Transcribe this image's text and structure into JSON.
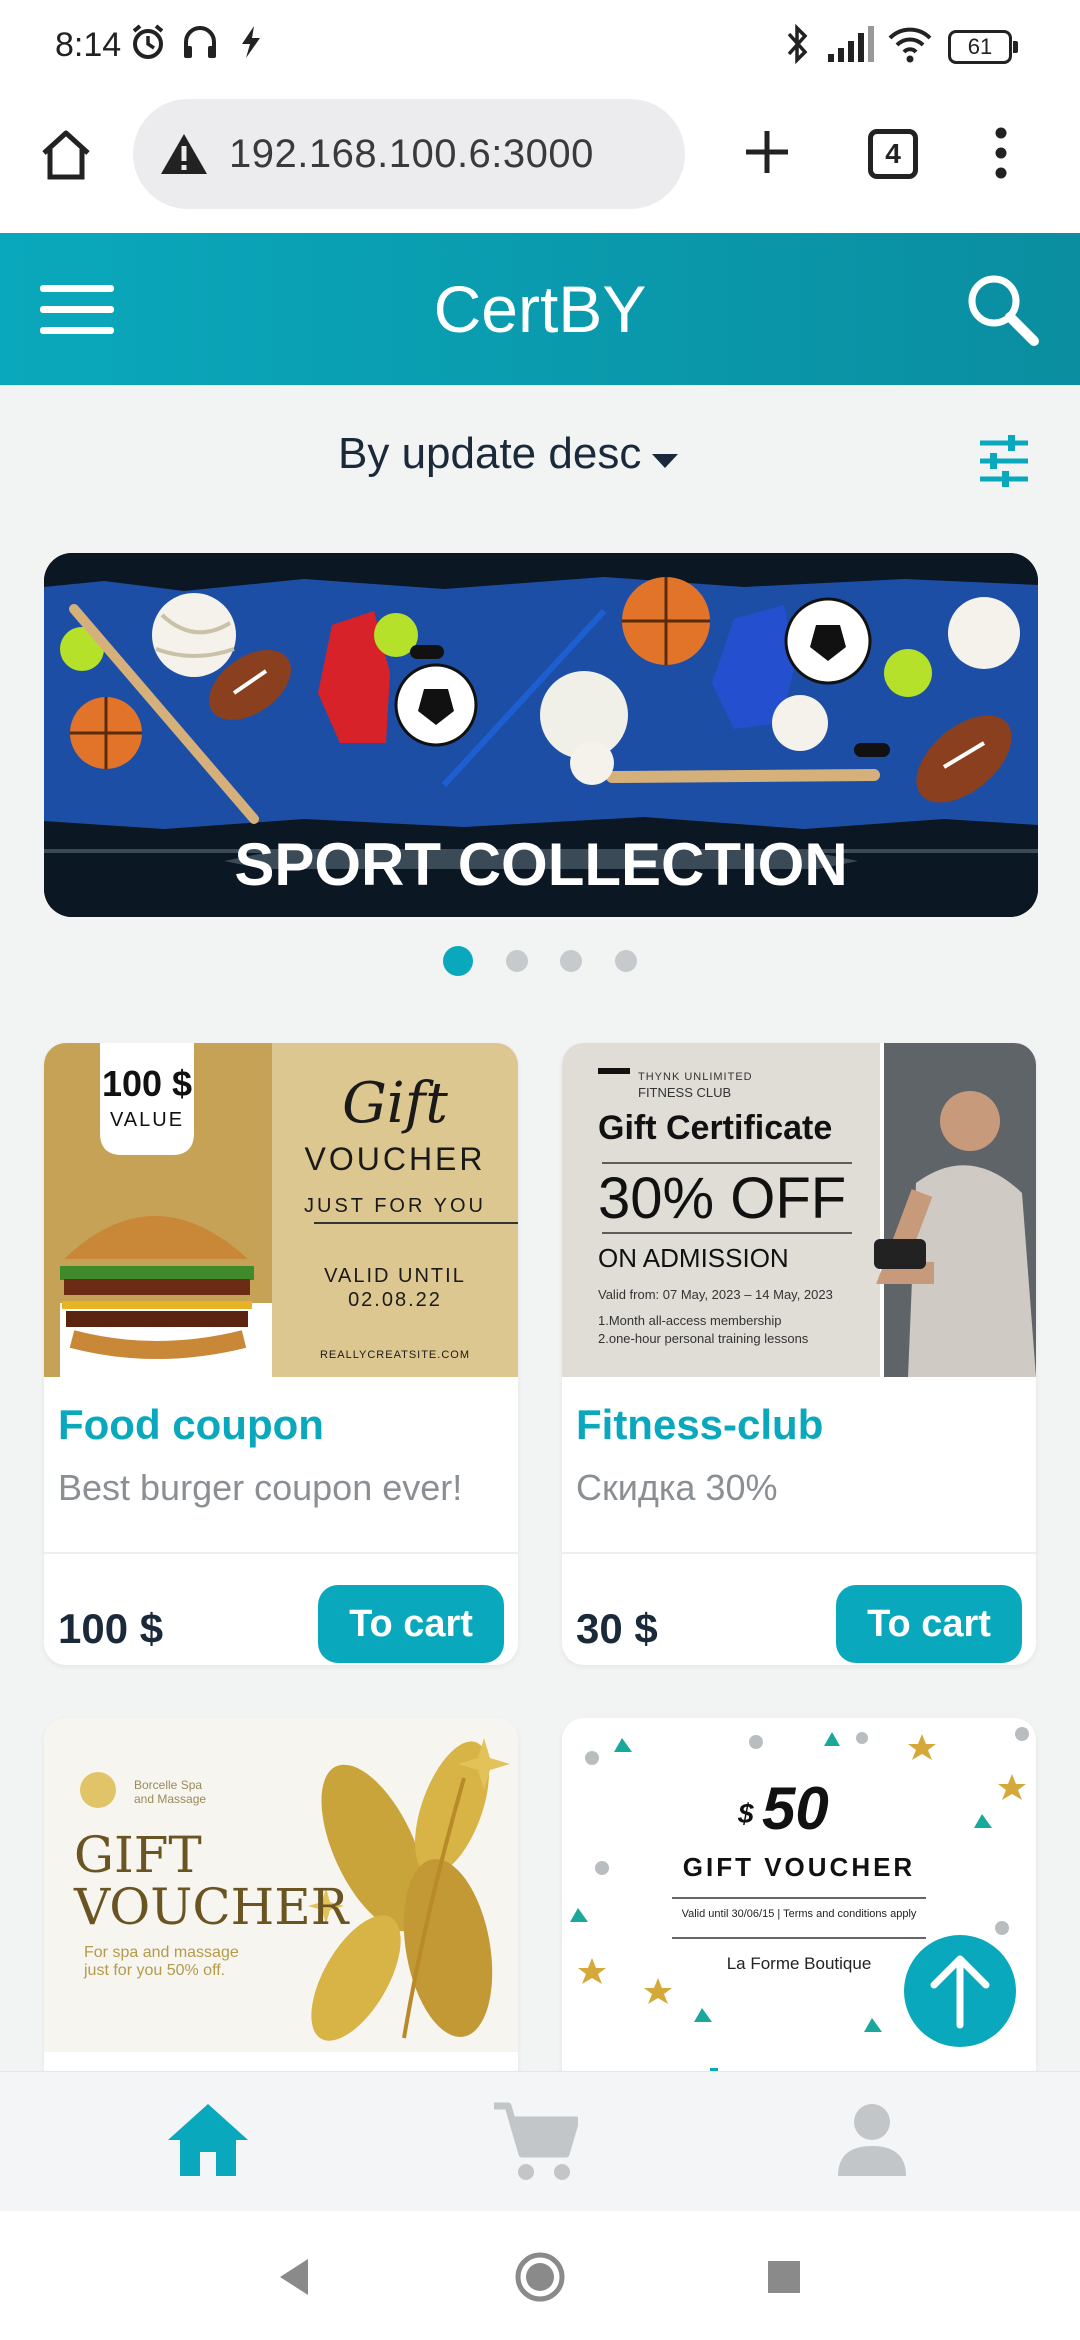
{
  "status_bar": {
    "time": "8:14",
    "battery": "61"
  },
  "browser": {
    "url": "192.168.100.6:3000",
    "tab_count": "4"
  },
  "header": {
    "title": "CertBY"
  },
  "sort": {
    "label": "By update desc"
  },
  "banner": {
    "caption": "SPORT COLLECTION",
    "slide_count": 4,
    "active_slide": 1
  },
  "products": [
    {
      "name": "Food coupon",
      "description": "Best burger coupon ever!",
      "price": "100 $",
      "button": "To cart",
      "image": {
        "badge_amount": "100 $",
        "badge_label": "VALUE",
        "heading_script": "Gift",
        "heading": "VOUCHER",
        "tagline": "JUST FOR YOU",
        "valid_line1": "VALID UNTIL",
        "valid_line2": "02.08.22",
        "site": "REALLYCREATSITE.COM"
      }
    },
    {
      "name": "Fitness-club",
      "description": "Скидка 30%",
      "price": "30 $",
      "button": "To cart",
      "image": {
        "brand_line1": "THYNK UNLIMITED",
        "brand_line2": "FITNESS CLUB",
        "heading": "Gift Certificate",
        "offer": "30% OFF",
        "sub": "ON ADMISSION",
        "valid": "Valid from: 07 May, 2023 – 14 May, 2023",
        "perk1": "1.Month all-access membership",
        "perk2": "2.one-hour personal training lessons"
      }
    },
    {
      "image": {
        "brand_line1": "Borcelle Spa",
        "brand_line2": "and Massage",
        "heading_line1": "GIFT",
        "heading_line2": "VOUCHER",
        "note_line1": "For spa and massage",
        "note_line2": "just for you 50% off."
      }
    },
    {
      "image": {
        "amount": "50",
        "currency": "$",
        "heading": "GIFT VOUCHER",
        "terms": "Valid until 30/06/15 | Terms and conditions apply",
        "shop": "La Forme Boutique"
      }
    }
  ],
  "colors": {
    "accent": "#0aa8bc",
    "text_dark": "#1b2a3a"
  }
}
